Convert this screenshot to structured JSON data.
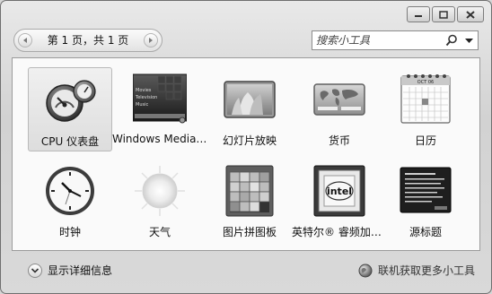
{
  "toolbar": {
    "page_label": "第 1 页，共 1 页",
    "search_placeholder": "搜索小工具"
  },
  "gadgets": [
    {
      "label": "CPU 仪表盘",
      "icon": "cpu-meter-icon",
      "selected": true
    },
    {
      "label": "Windows Media Center",
      "icon": "media-center-icon",
      "selected": false
    },
    {
      "label": "幻灯片放映",
      "icon": "slideshow-icon",
      "selected": false
    },
    {
      "label": "货币",
      "icon": "currency-icon",
      "selected": false
    },
    {
      "label": "日历",
      "icon": "calendar-icon",
      "selected": false
    },
    {
      "label": "时钟",
      "icon": "clock-icon",
      "selected": false
    },
    {
      "label": "天气",
      "icon": "weather-icon",
      "selected": false
    },
    {
      "label": "图片拼图板",
      "icon": "picture-puzzle-icon",
      "selected": false
    },
    {
      "label": "英特尔® 睿频加速技术监视器",
      "icon": "intel-chip-icon",
      "selected": false
    },
    {
      "label": "源标题",
      "icon": "feed-headlines-icon",
      "selected": false
    }
  ],
  "media_center_icon_text": [
    "Movies",
    "Television",
    "Music"
  ],
  "calendar_icon_text": "OCT 06",
  "intel_icon_text": "intel",
  "footer": {
    "details_label": "显示详细信息",
    "online_label": "联机获取更多小工具"
  }
}
